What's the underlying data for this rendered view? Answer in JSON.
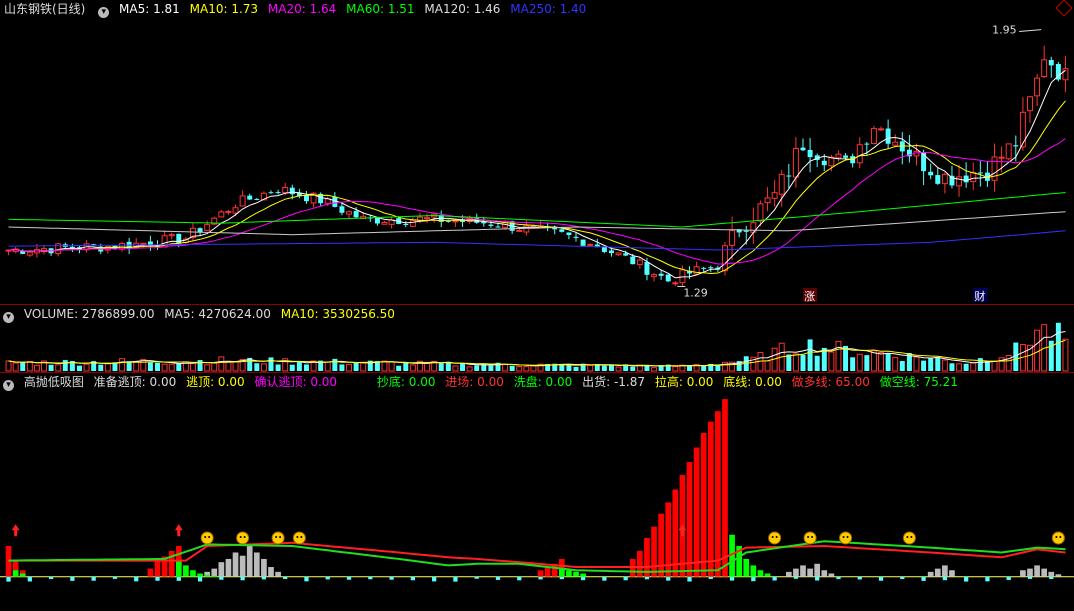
{
  "price_panel": {
    "title": "山东钢铁(日线)",
    "ma_labels": [
      {
        "text": "MA5: 1.81",
        "color": "#ffffff"
      },
      {
        "text": "MA10: 1.73",
        "color": "#ffff00"
      },
      {
        "text": "MA20: 1.64",
        "color": "#ff00ff"
      },
      {
        "text": "MA60: 1.51",
        "color": "#00ff00"
      },
      {
        "text": "MA120: 1.46",
        "color": "#dddddd"
      },
      {
        "text": "MA250: 1.40",
        "color": "#3333ff"
      }
    ],
    "high_label": "1.95",
    "low_label": "1.29",
    "markers": [
      "涨",
      "财"
    ]
  },
  "volume_panel": {
    "labels": [
      {
        "text": "VOLUME: 2786899.00",
        "color": "#dddddd"
      },
      {
        "text": "MA5: 4270624.00",
        "color": "#dddddd"
      },
      {
        "text": "MA10: 3530256.50",
        "color": "#ffff00"
      }
    ]
  },
  "indicator_panel": {
    "labels": [
      {
        "text": "高抛低吸图",
        "color": "#dddddd"
      },
      {
        "text": "准备逃顶: 0.00",
        "color": "#dddddd"
      },
      {
        "text": "逃顶: 0.00",
        "color": "#ffff00"
      },
      {
        "text": "确认逃顶: 0.00",
        "color": "#ff00ff"
      },
      {
        "text": "抄底: 0.00",
        "color": "#00ff00"
      },
      {
        "text": "进场: 0.00",
        "color": "#ff3333"
      },
      {
        "text": "洗盘: 0.00",
        "color": "#00ff00"
      },
      {
        "text": "出货: -1.87",
        "color": "#dddddd"
      },
      {
        "text": "拉高: 0.00",
        "color": "#ffff00"
      },
      {
        "text": "底线: 0.00",
        "color": "#ffff00"
      },
      {
        "text": "做多线: 65.00",
        "color": "#ff3333"
      },
      {
        "text": "做空线: 75.21",
        "color": "#00ff00"
      }
    ]
  },
  "colors": {
    "up": "#ff3232",
    "down": "#54ffff",
    "ma5": "#ffffff",
    "ma10": "#ffff00",
    "ma20": "#ff00ff",
    "ma60": "#00ff00",
    "ma120": "#cccccc",
    "ma250": "#3333ff",
    "border": "#8b0000"
  },
  "chart_data": [
    {
      "type": "line",
      "title": "山东钢铁(日线)",
      "y_range": [
        1.26,
        1.98
      ],
      "n_bars": 150,
      "anchors_close": [
        [
          0,
          1.38
        ],
        [
          15,
          1.39
        ],
        [
          25,
          1.41
        ],
        [
          32,
          1.5
        ],
        [
          38,
          1.54
        ],
        [
          44,
          1.51
        ],
        [
          50,
          1.46
        ],
        [
          60,
          1.46
        ],
        [
          68,
          1.45
        ],
        [
          78,
          1.42
        ],
        [
          82,
          1.4
        ],
        [
          88,
          1.35
        ],
        [
          93,
          1.3
        ],
        [
          96,
          1.32
        ],
        [
          100,
          1.34
        ],
        [
          103,
          1.44
        ],
        [
          108,
          1.52
        ],
        [
          112,
          1.66
        ],
        [
          118,
          1.6
        ],
        [
          122,
          1.71
        ],
        [
          125,
          1.67
        ],
        [
          128,
          1.62
        ],
        [
          132,
          1.57
        ],
        [
          138,
          1.59
        ],
        [
          142,
          1.66
        ],
        [
          145,
          1.82
        ],
        [
          146,
          1.89
        ],
        [
          149,
          1.83
        ]
      ],
      "ma_anchors": {
        "ma60": [
          [
            0,
            1.46
          ],
          [
            30,
            1.45
          ],
          [
            60,
            1.47
          ],
          [
            95,
            1.44
          ],
          [
            120,
            1.48
          ],
          [
            149,
            1.53
          ]
        ],
        "ma120": [
          [
            0,
            1.44
          ],
          [
            40,
            1.42
          ],
          [
            80,
            1.44
          ],
          [
            110,
            1.43
          ],
          [
            149,
            1.48
          ]
        ],
        "ma250": [
          [
            0,
            1.39
          ],
          [
            60,
            1.4
          ],
          [
            100,
            1.38
          ],
          [
            130,
            1.4
          ],
          [
            149,
            1.43
          ]
        ]
      }
    },
    {
      "type": "bar",
      "title": "VOLUME",
      "series_note": "volume",
      "anchors": [
        [
          0,
          0.7
        ],
        [
          30,
          0.9
        ],
        [
          45,
          0.8
        ],
        [
          60,
          0.6
        ],
        [
          80,
          0.5
        ],
        [
          95,
          0.4
        ],
        [
          105,
          1.0
        ],
        [
          112,
          2.3
        ],
        [
          118,
          1.8
        ],
        [
          124,
          1.5
        ],
        [
          135,
          0.7
        ],
        [
          142,
          1.8
        ],
        [
          145,
          3.6
        ],
        [
          149,
          2.8
        ]
      ],
      "y_range": [
        0,
        4.5
      ]
    },
    {
      "type": "bar",
      "title": "高抛低吸图",
      "red_bar_groups": [
        [
          0,
          2,
          [
            38,
            20,
            8
          ]
        ],
        [
          20,
          25,
          [
            10,
            20,
            25,
            32,
            38
          ]
        ],
        [
          75,
          79,
          [
            8,
            12,
            16,
            22
          ]
        ],
        [
          88,
          102,
          [
            22,
            32,
            48,
            62,
            78,
            92,
            108,
            126,
            142,
            160,
            178,
            192,
            205,
            220
          ]
        ]
      ],
      "green_bar_groups": [
        [
          1,
          3,
          [
            8,
            4
          ]
        ],
        [
          24,
          29,
          [
            20,
            14,
            8,
            4,
            2,
            1
          ]
        ],
        [
          78,
          82,
          [
            10,
            8,
            6,
            4
          ]
        ],
        [
          102,
          108,
          [
            52,
            38,
            22,
            14,
            8,
            4
          ]
        ]
      ],
      "neg_bar_groups": [
        [
          28,
          42,
          [
            6,
            10,
            18,
            22,
            30,
            26,
            38,
            30,
            22,
            12,
            6
          ]
        ],
        [
          110,
          122,
          [
            6,
            10,
            14,
            10,
            16,
            8,
            4
          ]
        ],
        [
          130,
          136,
          [
            6,
            10,
            14,
            8
          ]
        ],
        [
          143,
          149,
          [
            8,
            10,
            14,
            10,
            6,
            3
          ]
        ]
      ],
      "y_range": [
        -40,
        230
      ],
      "line_long_anchors": [
        [
          0,
          20
        ],
        [
          25,
          20
        ],
        [
          28,
          38
        ],
        [
          40,
          42
        ],
        [
          55,
          30
        ],
        [
          62,
          24
        ],
        [
          66,
          22
        ],
        [
          72,
          18
        ],
        [
          80,
          12
        ],
        [
          90,
          12
        ],
        [
          100,
          20
        ],
        [
          104,
          36
        ],
        [
          115,
          38
        ],
        [
          130,
          30
        ],
        [
          140,
          24
        ],
        [
          145,
          34
        ],
        [
          149,
          30
        ]
      ],
      "line_short_anchors": [
        [
          0,
          20
        ],
        [
          22,
          22
        ],
        [
          28,
          40
        ],
        [
          40,
          38
        ],
        [
          55,
          22
        ],
        [
          62,
          14
        ],
        [
          66,
          16
        ],
        [
          72,
          16
        ],
        [
          80,
          8
        ],
        [
          90,
          6
        ],
        [
          100,
          8
        ],
        [
          104,
          30
        ],
        [
          115,
          44
        ],
        [
          130,
          36
        ],
        [
          140,
          30
        ],
        [
          145,
          36
        ],
        [
          149,
          34
        ]
      ]
    }
  ]
}
